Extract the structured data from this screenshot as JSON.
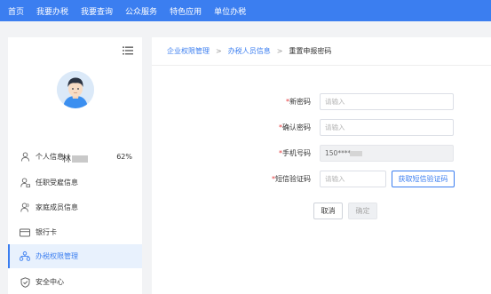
{
  "topnav": {
    "items": [
      "首页",
      "我要办税",
      "我要查询",
      "公众服务",
      "特色应用",
      "单位办税"
    ]
  },
  "profile": {
    "name": "林"
  },
  "sidebar": {
    "items": [
      {
        "label": "个人信息",
        "icon": "user-icon",
        "percent": "62%"
      },
      {
        "label": "任职受雇信息",
        "icon": "user-briefcase-icon"
      },
      {
        "label": "家庭成员信息",
        "icon": "family-icon"
      },
      {
        "label": "银行卡",
        "icon": "card-icon"
      },
      {
        "label": "办税权限管理",
        "icon": "org-tree-icon",
        "active": true
      },
      {
        "label": "安全中心",
        "icon": "shield-icon"
      }
    ]
  },
  "breadcrumb": {
    "items": [
      "企业权限管理",
      "办税人员信息",
      "重置申报密码"
    ]
  },
  "form": {
    "new_password": {
      "label": "新密码",
      "placeholder": "请输入"
    },
    "confirm_password": {
      "label": "确认密码",
      "placeholder": "请输入"
    },
    "phone": {
      "label": "手机号码",
      "value": "150****"
    },
    "sms_code": {
      "label": "短信验证码",
      "placeholder": "请输入",
      "button": "获取短信验证码"
    },
    "required_mark": "*",
    "cancel_label": "取消",
    "confirm_label": "确定"
  },
  "colors": {
    "primary": "#3b7ef0",
    "required": "#e4393c"
  }
}
